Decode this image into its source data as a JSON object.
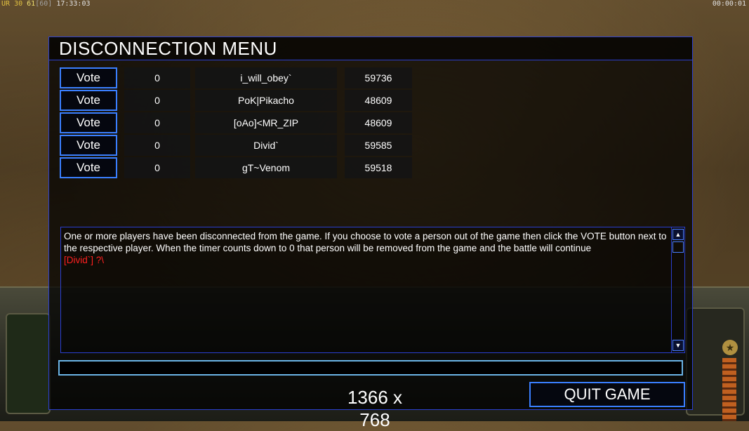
{
  "hud": {
    "ur_label": "UR",
    "ur_value": "30",
    "fps": "61",
    "fps_cap": "[60]",
    "clock": "17:33:03",
    "game_timer": "00:00:01"
  },
  "dialog": {
    "title": "DISCONNECTION MENU",
    "vote_label": "Vote",
    "players": [
      {
        "votes": "0",
        "name": "i_will_obey`",
        "ping": "59736"
      },
      {
        "votes": "0",
        "name": "PoK|Pikacho",
        "ping": "48609"
      },
      {
        "votes": "0",
        "name": "[oAo]<MR_ZIP",
        "ping": "48609"
      },
      {
        "votes": "0",
        "name": "Divid`",
        "ping": "59585"
      },
      {
        "votes": "0",
        "name": "gT~Venom",
        "ping": "59518"
      }
    ],
    "message": "One or more players have been disconnected from the game. If you choose to vote a person out of the game then click the VOTE button next to the respective player. When the timer counts down to 0 that person will be removed from the game and the battle will continue",
    "chat_line": "[Divid`] ?\\",
    "chat_input_value": "",
    "resolution": "1366 x 768",
    "quit_label": "QUIT GAME"
  },
  "colors": {
    "border": "#2b3fd0",
    "button_border": "#3a7fff",
    "chat_red": "#ff2020",
    "input_border": "#6ab4e6"
  }
}
